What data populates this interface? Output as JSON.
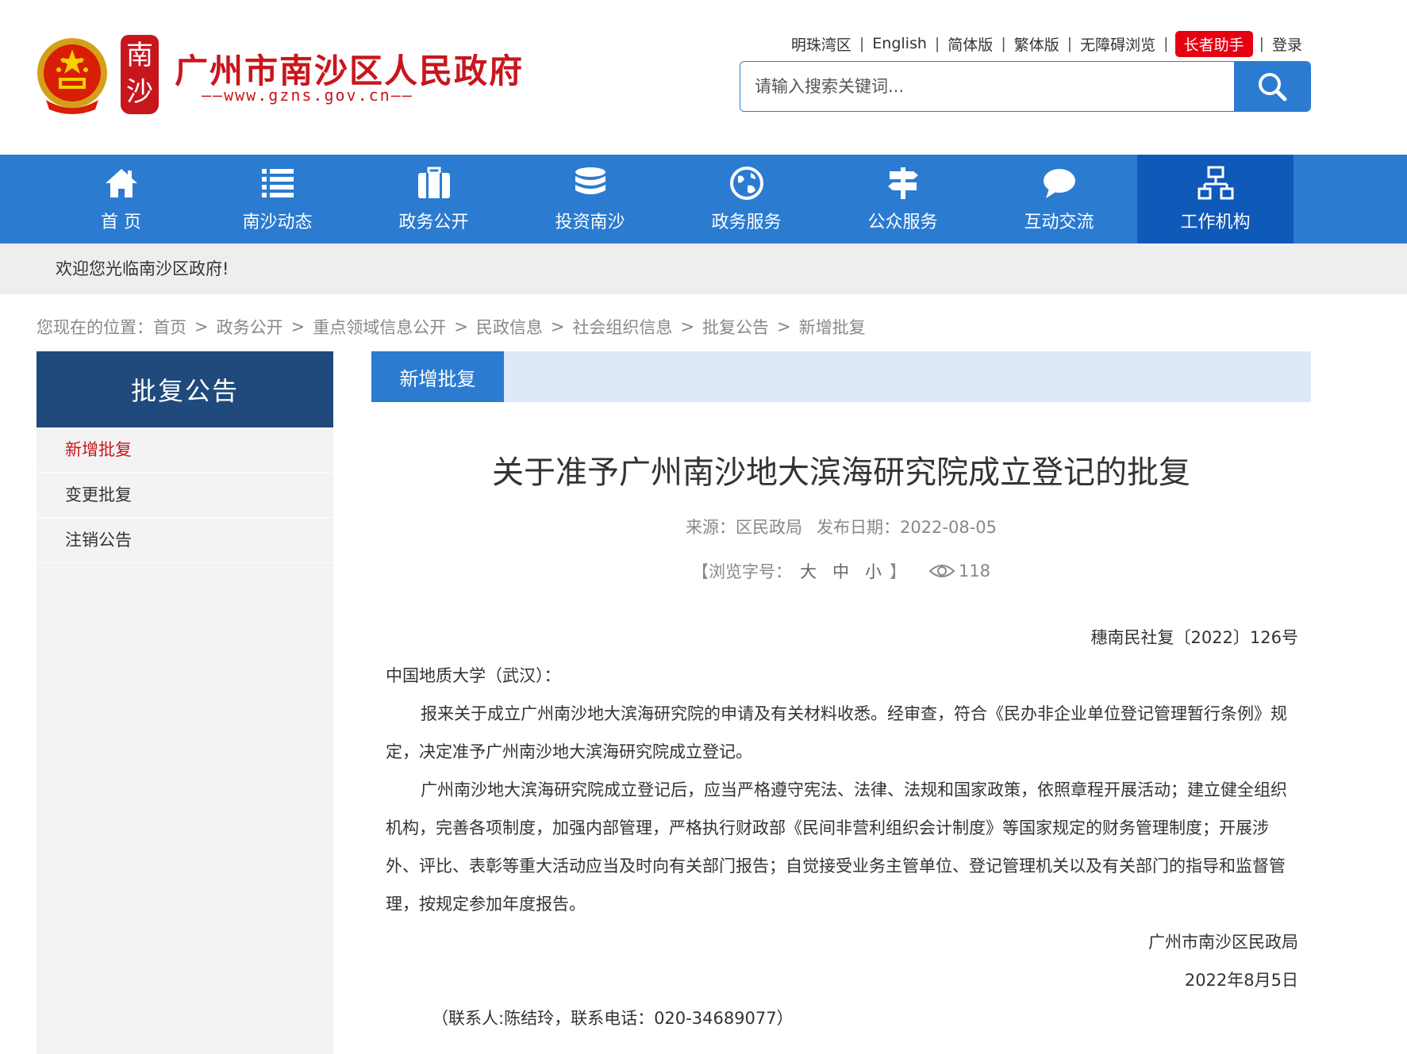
{
  "site": {
    "title": "广州市南沙区人民政府",
    "url": "——www.gzns.gov.cn——",
    "seal_chars": [
      "南",
      "沙"
    ]
  },
  "toplinks": [
    {
      "label": "明珠湾区"
    },
    {
      "label": "English"
    },
    {
      "label": "简体版"
    },
    {
      "label": "繁体版"
    },
    {
      "label": "无障碍浏览"
    },
    {
      "label": "长者助手"
    },
    {
      "label": "登录"
    }
  ],
  "search": {
    "placeholder": "请输入搜索关键词..."
  },
  "nav": [
    {
      "label": "首 页",
      "icon": "home-icon"
    },
    {
      "label": "南沙动态",
      "icon": "list-icon"
    },
    {
      "label": "政务公开",
      "icon": "briefcase-icon"
    },
    {
      "label": "投资南沙",
      "icon": "coins-icon"
    },
    {
      "label": "政务服务",
      "icon": "globe-icon"
    },
    {
      "label": "公众服务",
      "icon": "signpost-icon"
    },
    {
      "label": "互动交流",
      "icon": "chat-icon"
    },
    {
      "label": "工作机构",
      "icon": "org-chart-icon"
    }
  ],
  "welcome": "欢迎您光临南沙区政府!",
  "breadcrumb": {
    "prefix": "您现在的位置：",
    "items": [
      "首页",
      "政务公开",
      "重点领域信息公开",
      "民政信息",
      "社会组织信息",
      "批复公告",
      "新增批复"
    ],
    "separator": ">"
  },
  "sidebar": {
    "title": "批复公告",
    "items": [
      {
        "label": "新增批复"
      },
      {
        "label": "变更批复"
      },
      {
        "label": "注销公告"
      }
    ]
  },
  "content": {
    "tab": "新增批复",
    "title": "关于准予广州南沙地大滨海研究院成立登记的批复",
    "source": "来源：区民政局",
    "date": "发布日期：2022-08-05",
    "font_label": "【浏览字号：",
    "font_sizes": [
      "大",
      "中",
      "小"
    ],
    "font_end": "】",
    "views": "118",
    "doc_no": "穗南民社复〔2022〕126号",
    "addressee": "中国地质大学（武汉）：",
    "para1": "报来关于成立广州南沙地大滨海研究院的申请及有关材料收悉。经审查，符合《民办非企业单位登记管理暂行条例》规定，决定准予广州南沙地大滨海研究院成立登记。",
    "para2": "广州南沙地大滨海研究院成立登记后，应当严格遵守宪法、法律、法规和国家政策，依照章程开展活动；建立健全组织机构，完善各项制度，加强内部管理，严格执行财政部《民间非营利组织会计制度》等国家规定的财务管理制度；开展涉外、评比、表彰等重大活动应当及时向有关部门报告；自觉接受业务主管单位、登记管理机关以及有关部门的指导和监督管理，按规定参加年度报告。",
    "signer": "广州市南沙区民政局",
    "sign_date": "2022年8月5日",
    "contact": "（联系人:陈结玲，联系电话：020-34689077）"
  },
  "colors": {
    "brand_red": "#c8161d",
    "nav_blue": "#2b7bd1",
    "nav_active": "#0f59b8",
    "sidebar_head": "#1f4a7b"
  }
}
